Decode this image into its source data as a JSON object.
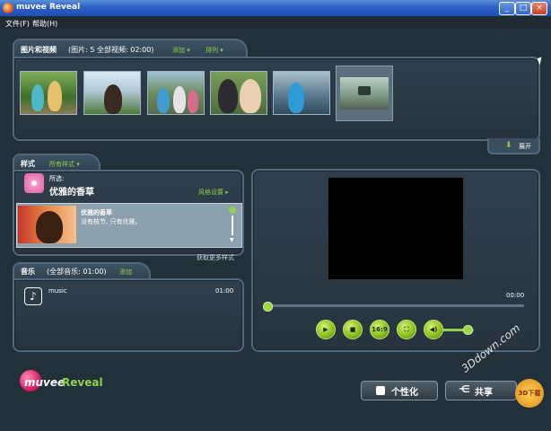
{
  "window": {
    "title": "muvee Reveal",
    "minimize": "_",
    "maximize": "□",
    "close": "×"
  },
  "menu": {
    "file": "文件(F)",
    "help": "帮助(H)"
  },
  "media": {
    "header": "图片和视频",
    "summary": "(图片: 5 全部视频: 02:00)",
    "add_label": "添加",
    "sort_label": "排列",
    "expand_label": "展开",
    "thumbnails": [
      "photo-1",
      "photo-2",
      "photo-3",
      "photo-4",
      "photo-5",
      "video-1"
    ]
  },
  "style": {
    "header": "样式",
    "filter_label": "所有样式",
    "selected_prefix": "所选:",
    "selected_name": "优雅的香草",
    "settings_label": "风格设置",
    "item_title": "优雅的香草",
    "item_desc": "没有枝节, 只有优雅。",
    "more_styles": "获取更多样式"
  },
  "music": {
    "header": "音乐",
    "summary": "(全部音乐: 01:00)",
    "add_label": "添加",
    "track_name": "music",
    "track_time": "01:00"
  },
  "player": {
    "time": "00:00",
    "aspect_label": "16:9",
    "progress": 0,
    "volume": 0.75
  },
  "brand": {
    "logo_part1": "muvee",
    "logo_part2": "Reveal"
  },
  "actions": {
    "personalize": "个性化",
    "share": "共享"
  },
  "watermark": {
    "line1": "3Ddown.com",
    "line2": "3D下载"
  }
}
